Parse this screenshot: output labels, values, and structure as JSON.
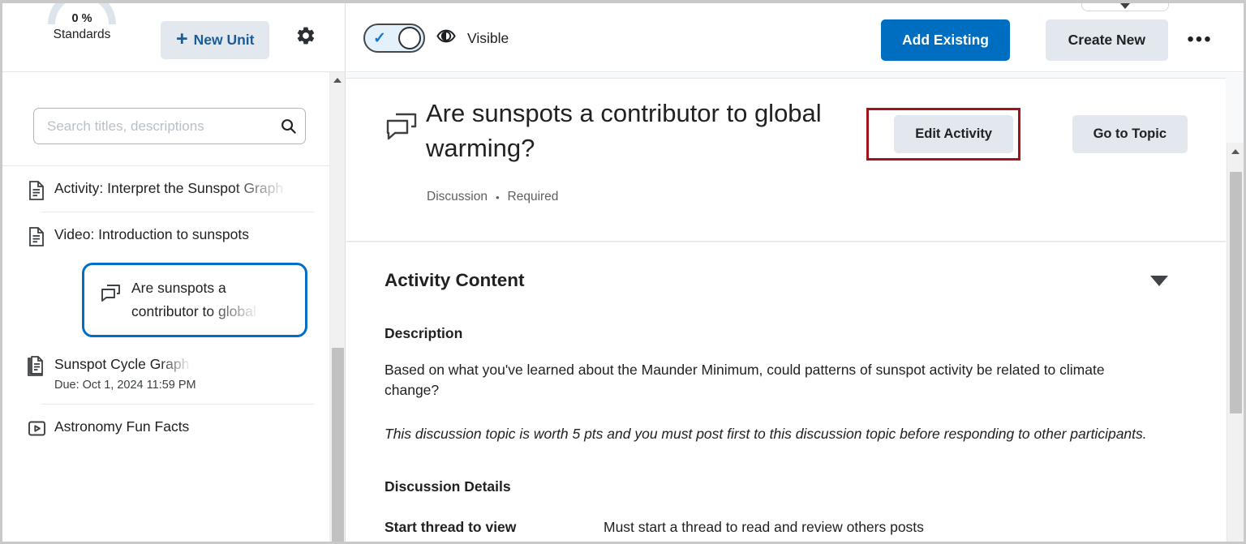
{
  "sidebar": {
    "gauge": {
      "percent": "0 %",
      "label": "Standards",
      "arc_color": "#dde4ec"
    },
    "new_unit_button": {
      "label": "New Unit",
      "plus": "+"
    },
    "gear_icon": "gear-icon",
    "search": {
      "placeholder": "Search titles, descriptions",
      "value": "",
      "icon": "search-icon"
    },
    "items": [
      {
        "title": "Activity: Interpret the Sunspot Graph",
        "icon": "document-icon",
        "subtitle": "",
        "selected": false
      },
      {
        "title": "Video: Introduction to sunspots",
        "icon": "document-icon",
        "subtitle": "",
        "selected": false
      },
      {
        "title": "Are sunspots a contributor to global",
        "icon": "discussion-icon",
        "subtitle": "",
        "selected": true
      },
      {
        "title": "Sunspot Cycle Graph",
        "icon": "assignment-icon",
        "subtitle": "Due: Oct 1, 2024 11:59 PM",
        "selected": false
      },
      {
        "title": "Astronomy Fun Facts",
        "icon": "video-icon",
        "subtitle": "",
        "selected": false
      }
    ]
  },
  "topbar": {
    "toggle": {
      "state": "on",
      "check": "✓"
    },
    "visibility_icon": "eye-icon",
    "visibility_label": "Visible",
    "add_existing_label": "Add Existing",
    "create_new_label": "Create New",
    "more_label": "•••",
    "accent_color": "#006ec0",
    "partial_dropdown_icon": "chevron-down-icon"
  },
  "activity": {
    "icon": "discussion-icon",
    "title": "Are sunspots a contributor to global warming?",
    "type": "Discussion",
    "separator": "•",
    "requirement": "Required",
    "edit_button_label": "Edit Activity",
    "goto_button_label": "Go to Topic",
    "highlight_color": "#a01318"
  },
  "content": {
    "section_title": "Activity Content",
    "collapse_icon": "caret-down-icon",
    "description_heading": "Description",
    "description_paragraph": "Based on what you've learned about the Maunder Minimum, could patterns of sunspot activity be related to climate change?",
    "description_note": "This discussion topic is worth 5 pts and you must post first to this discussion topic before responding to other participants.",
    "details_heading": "Discussion Details",
    "details_rows": [
      {
        "label": "Start thread to view",
        "value": "Must start a thread to read and review others posts"
      }
    ]
  }
}
